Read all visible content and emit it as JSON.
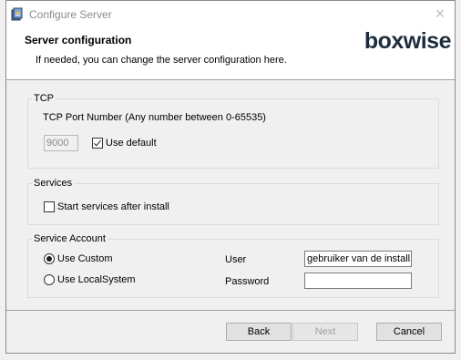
{
  "window": {
    "title": "Configure Server",
    "close_glyph": "✕"
  },
  "header": {
    "title": "Server configuration",
    "subtitle": "If needed, you can change the server configuration here.",
    "logo_text": "boxwise",
    "logo_color": "#1e2d3b"
  },
  "tcp": {
    "legend": "TCP",
    "port_label": "TCP Port Number (Any number between 0-65535)",
    "port_value": "9000",
    "use_default_label": "Use default",
    "use_default_checked": true
  },
  "services": {
    "legend": "Services",
    "start_label": "Start services after install",
    "start_checked": false
  },
  "account": {
    "legend": "Service Account",
    "use_custom_label": "Use Custom",
    "use_localsystem_label": "Use LocalSystem",
    "selected": "Use Custom",
    "user_label": "User",
    "user_value": "gebruiker van de install",
    "password_label": "Password",
    "password_value": ""
  },
  "buttons": {
    "back": "Back",
    "next": "Next",
    "cancel": "Cancel"
  }
}
